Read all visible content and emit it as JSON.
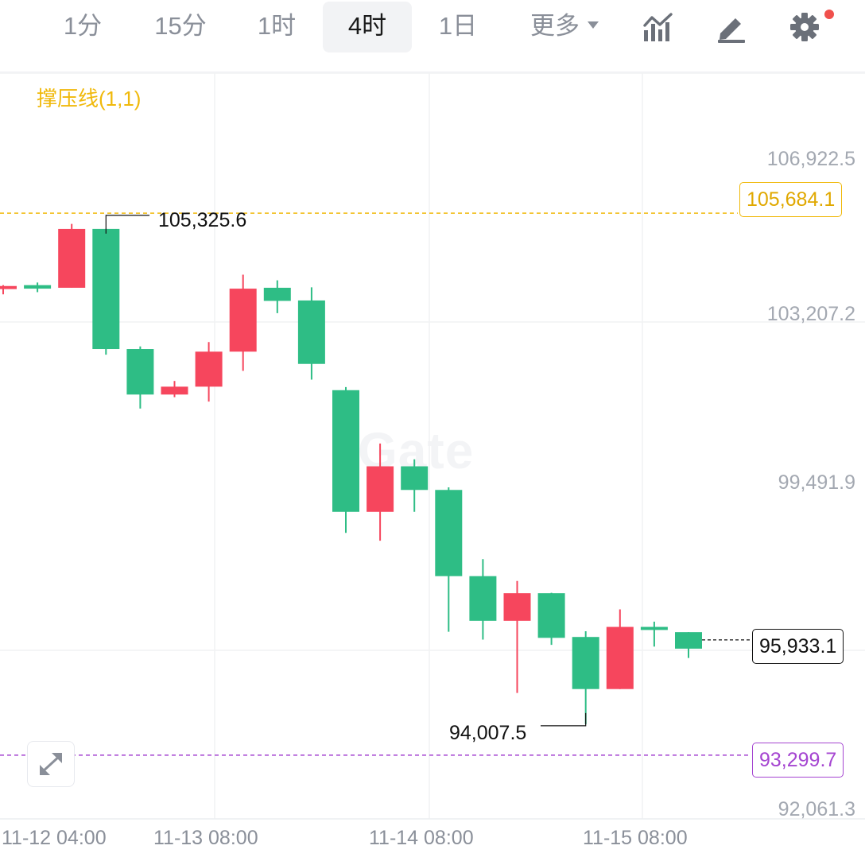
{
  "toolbar": {
    "tabs": [
      {
        "label": "1分",
        "active": false
      },
      {
        "label": "15分",
        "active": false
      },
      {
        "label": "1时",
        "active": false
      },
      {
        "label": "4时",
        "active": true
      },
      {
        "label": "1日",
        "active": false
      },
      {
        "label": "更多",
        "active": false
      }
    ],
    "icons": [
      "indicator-chart-icon",
      "draw-pen-icon",
      "settings-gear-icon"
    ],
    "settings_notification": true
  },
  "indicator": {
    "label": "撑压线(1,1)",
    "color": "#f0b90b"
  },
  "watermark": "Gate",
  "colors": {
    "up": "#f6465d",
    "down": "#2ebd85",
    "resistance": "#f0b90b",
    "support": "#a545d1"
  },
  "price_axis": [
    "106,922.5",
    "103,207.2",
    "99,491.9",
    "92,061.3"
  ],
  "resistance": {
    "value": "105,684.1"
  },
  "support": {
    "value": "93,299.7"
  },
  "current_price": {
    "value": "95,933.1"
  },
  "high_marker": {
    "value": "105,325.6"
  },
  "low_marker": {
    "value": "94,007.5"
  },
  "time_axis": [
    "11-12 04:00",
    "11-13 08:00",
    "11-14 08:00",
    "11-15 08:00"
  ],
  "chart_data": {
    "type": "candlestick",
    "interval": "4时",
    "candles": [
      {
        "o": 104020,
        "h": 104040,
        "l": 103830,
        "c": 103950,
        "dir": "up"
      },
      {
        "o": 103960,
        "h": 104100,
        "l": 103880,
        "c": 104040,
        "dir": "down"
      },
      {
        "o": 103980,
        "h": 105440,
        "l": 103980,
        "c": 105325,
        "dir": "up"
      },
      {
        "o": 105325.6,
        "h": 105325.6,
        "l": 102450,
        "c": 102580,
        "dir": "down"
      },
      {
        "o": 102580,
        "h": 102640,
        "l": 101220,
        "c": 101540,
        "dir": "down"
      },
      {
        "o": 101540,
        "h": 101850,
        "l": 101480,
        "c": 101720,
        "dir": "up"
      },
      {
        "o": 101720,
        "h": 102740,
        "l": 101380,
        "c": 102520,
        "dir": "up"
      },
      {
        "o": 102520,
        "h": 104280,
        "l": 102080,
        "c": 103960,
        "dir": "up"
      },
      {
        "o": 103980,
        "h": 104150,
        "l": 103400,
        "c": 103680,
        "dir": "down"
      },
      {
        "o": 103690,
        "h": 103990,
        "l": 101880,
        "c": 102240,
        "dir": "down"
      },
      {
        "o": 101640,
        "h": 101710,
        "l": 98380,
        "c": 98860,
        "dir": "down"
      },
      {
        "o": 98860,
        "h": 100420,
        "l": 98200,
        "c": 99900,
        "dir": "up"
      },
      {
        "o": 99900,
        "h": 100060,
        "l": 98860,
        "c": 99360,
        "dir": "down"
      },
      {
        "o": 99360,
        "h": 99420,
        "l": 96120,
        "c": 97390,
        "dir": "down"
      },
      {
        "o": 97390,
        "h": 97780,
        "l": 95940,
        "c": 96370,
        "dir": "down"
      },
      {
        "o": 96370,
        "h": 97280,
        "l": 94720,
        "c": 97000,
        "dir": "up"
      },
      {
        "o": 97000,
        "h": 97010,
        "l": 95820,
        "c": 95980,
        "dir": "down"
      },
      {
        "o": 96000,
        "h": 96130,
        "l": 94007.5,
        "c": 94810,
        "dir": "down"
      },
      {
        "o": 94810,
        "h": 96630,
        "l": 94810,
        "c": 96230,
        "dir": "up"
      },
      {
        "o": 96230,
        "h": 96350,
        "l": 95780,
        "c": 96160,
        "dir": "down"
      },
      {
        "o": 96110,
        "h": 96110,
        "l": 95520,
        "c": 95733,
        "dir": "down"
      }
    ],
    "ylim": [
      92061.3,
      106922.5
    ]
  }
}
